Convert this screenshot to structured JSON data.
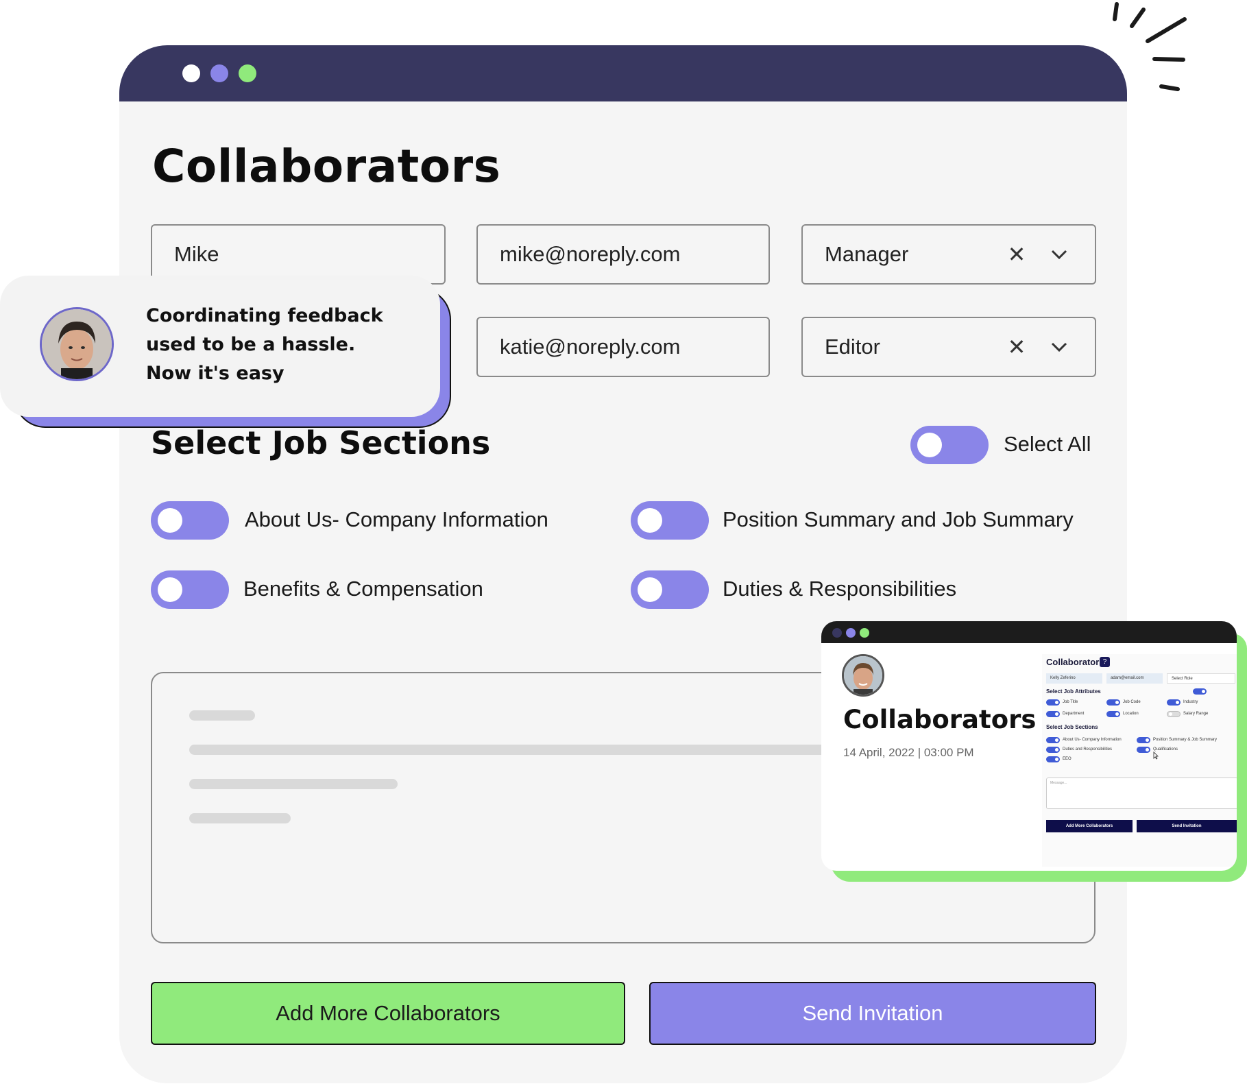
{
  "page": {
    "title": "Collaborators"
  },
  "collaborators": [
    {
      "name": "Mike",
      "email": "mike@noreply.com",
      "role": "Manager"
    },
    {
      "name": "",
      "email": "katie@noreply.com",
      "role": "Editor"
    }
  ],
  "job_sections": {
    "title": "Select Job Sections",
    "select_all_label": "Select All",
    "select_all_on": false,
    "items": [
      {
        "label": "About Us- Company Information",
        "on": false
      },
      {
        "label": "Position Summary and Job Summary",
        "on": false
      },
      {
        "label": "Benefits & Compensation",
        "on": false
      },
      {
        "label": "Duties & Responsibilities",
        "on": false
      }
    ]
  },
  "buttons": {
    "add_more": "Add More Collaborators",
    "send": "Send Invitation"
  },
  "testimonial": {
    "lines": [
      "Coordinating feedback",
      "used to be a hassle.",
      "Now it's easy"
    ]
  },
  "preview": {
    "title": "Collaborators",
    "date": "14 April, 2022 | 03:00 PM",
    "mini": {
      "title": "Collaborators",
      "name_input": "Kelly Zeferino",
      "email_input": "adam@email.com",
      "role_input": "Select Role",
      "attributes_heading": "Select Job Attributes",
      "attributes": [
        "Job Title",
        "Job Code",
        "Industry",
        "Department",
        "Location",
        "Salary Range"
      ],
      "sections_heading": "Select Job Sections",
      "sections": [
        "About Us- Company Information",
        "Position Summary & Job Summary",
        "Duties and Responsibilities",
        "Qualifications",
        "EEO"
      ],
      "message_placeholder": "Message...",
      "add_button": "Add More Collaborators",
      "send_button": "Send Invitation"
    }
  },
  "colors": {
    "titlebar": "#383760",
    "accent_purple": "#8a85e8",
    "accent_green": "#90ea7c",
    "dot_white": "#ffffff",
    "dot_purple": "#8a85e8",
    "dot_green": "#90ea7c"
  }
}
